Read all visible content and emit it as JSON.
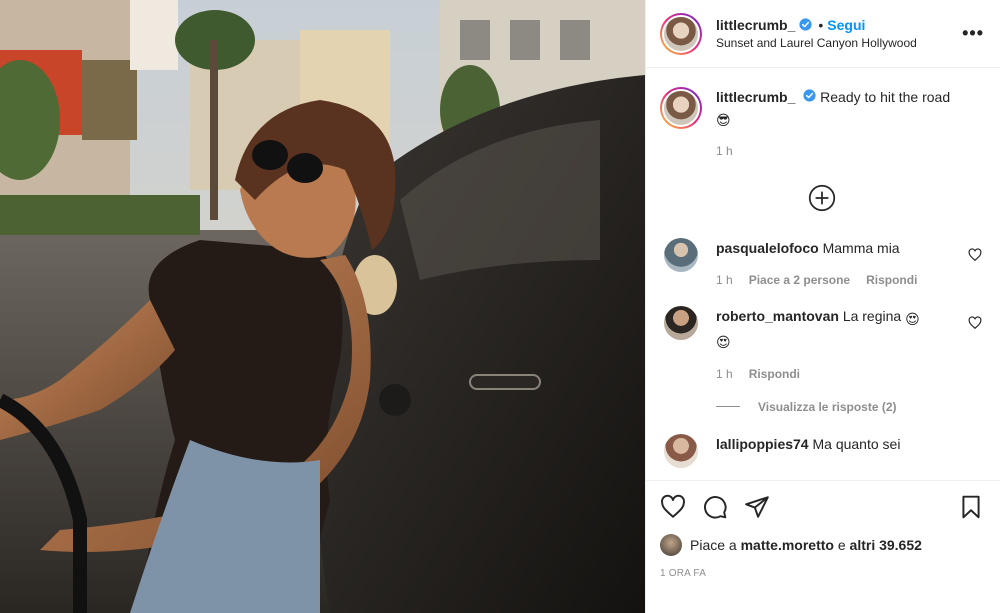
{
  "post": {
    "username": "littlecrumb_",
    "follow_label": "Segui",
    "separator": "•",
    "location": "Sunset and Laurel Canyon Hollywood",
    "more_label": "•••"
  },
  "caption": {
    "username": "littlecrumb_",
    "text": "Ready to hit the road",
    "emoji": "😎",
    "time": "1 h"
  },
  "comments": [
    {
      "username": "pasqualelofoco",
      "text": "Mamma mia",
      "emoji": "",
      "time": "1 h",
      "likes": "Piace a 2 persone",
      "reply_label": "Rispondi"
    },
    {
      "username": "roberto_mantovan",
      "text": "La regina",
      "emoji": "😍",
      "emoji2": "😍",
      "time": "1 h",
      "reply_label": "Rispondi",
      "view_replies": "Visualizza le risposte (2)"
    },
    {
      "username": "lallipoppies74",
      "text": "Ma quanto sei"
    }
  ],
  "likes_line": {
    "prefix": "Piace a",
    "user": "matte.moretto",
    "conj": "e",
    "others": "altri 39.652"
  },
  "timestamp": "1 ORA FA",
  "icons": [
    "verified-badge-icon",
    "more-icon",
    "add-circle-icon",
    "heart-icon",
    "comment-icon",
    "share-icon",
    "bookmark-icon"
  ],
  "colors": {
    "accent": "#0095f6",
    "text": "#262626",
    "muted": "#8e8e8e",
    "border": "#efefef"
  }
}
